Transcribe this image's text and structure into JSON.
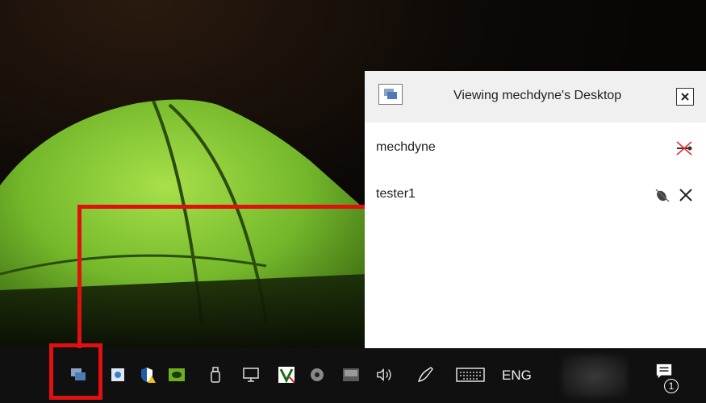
{
  "popup": {
    "title": "Viewing mechdyne's Desktop",
    "users": [
      {
        "name": "mechdyne"
      },
      {
        "name": "tester1"
      }
    ]
  },
  "taskbar": {
    "language": "ENG",
    "notification_count": "1"
  },
  "colors": {
    "highlight": "#e01010",
    "taskbar": "#101010",
    "tent_green": "#7fc12f"
  }
}
